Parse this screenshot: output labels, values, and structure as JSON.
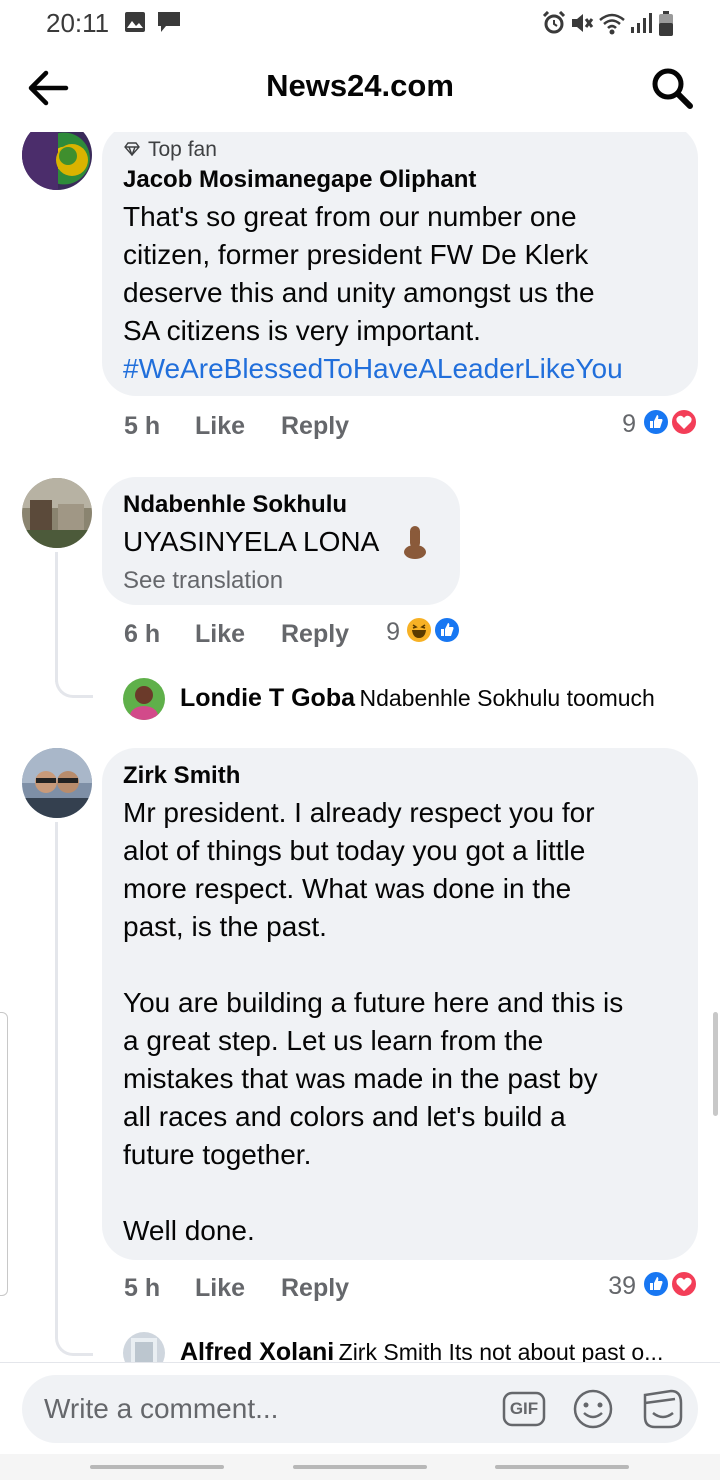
{
  "status_bar": {
    "time": "20:11",
    "left_icons": [
      "image-icon",
      "message-icon"
    ],
    "right_icons": [
      "alarm-icon",
      "mute-icon",
      "wifi-icon",
      "signal-icon",
      "battery-icon"
    ]
  },
  "header": {
    "title": "News24.com",
    "back_icon": "arrow-left-icon",
    "search_icon": "search-icon"
  },
  "comments": [
    {
      "badge": "Top fan",
      "author": "Jacob Mosimanegape Oliphant",
      "lines": [
        "That's so great from our number one",
        "citizen, former president FW De Klerk",
        "deserve this and unity amongst us the",
        "SA citizens is very important."
      ],
      "hashtag": "#WeAreBlessedToHaveALeaderLikeYou",
      "time": "5 h",
      "like": "Like",
      "reply": "Reply",
      "reaction_count": "9",
      "reactions": [
        "like-reaction-icon",
        "love-reaction-icon"
      ]
    },
    {
      "author": "Ndabenhle Sokhulu",
      "text": "UYASINYELA LONA",
      "see_translation": "See translation",
      "time": "6 h",
      "like": "Like",
      "reply": "Reply",
      "reaction_count": "9",
      "reactions": [
        "haha-reaction-icon",
        "like-reaction-icon"
      ],
      "reply_preview": {
        "author": "Londie T Goba",
        "text": "Ndabenhle Sokhulu toomuch"
      }
    },
    {
      "author": "Zirk Smith",
      "lines": [
        "Mr president.  I already respect you for",
        "alot of things but today you got a little",
        "more respect. What was done in the",
        "past, is the past.",
        "",
        "You are building a future here and this is",
        "a great step.  Let us learn from the",
        "mistakes that was made in the past by",
        "all races and colors and let's  build a",
        "future together.",
        "",
        "Well done."
      ],
      "time": "5 h",
      "like": "Like",
      "reply": "Reply",
      "reaction_count": "39",
      "reactions": [
        "like-reaction-icon",
        "love-reaction-icon"
      ],
      "reply_preview": {
        "author": "Alfred Xolani",
        "text": "Zirk Smith Its not about past o..."
      }
    }
  ],
  "composer": {
    "placeholder": "Write a comment...",
    "icons": [
      "gif-icon",
      "emoji-icon",
      "sticker-icon"
    ],
    "gif_label": "GIF"
  },
  "colors": {
    "like_blue": "#1877f2",
    "love_red": "#f33e58",
    "haha_yellow": "#f7b125",
    "hashtag_blue": "#216fdb",
    "bubble_gray": "#f0f2f5",
    "secondary_text": "#65676b"
  }
}
